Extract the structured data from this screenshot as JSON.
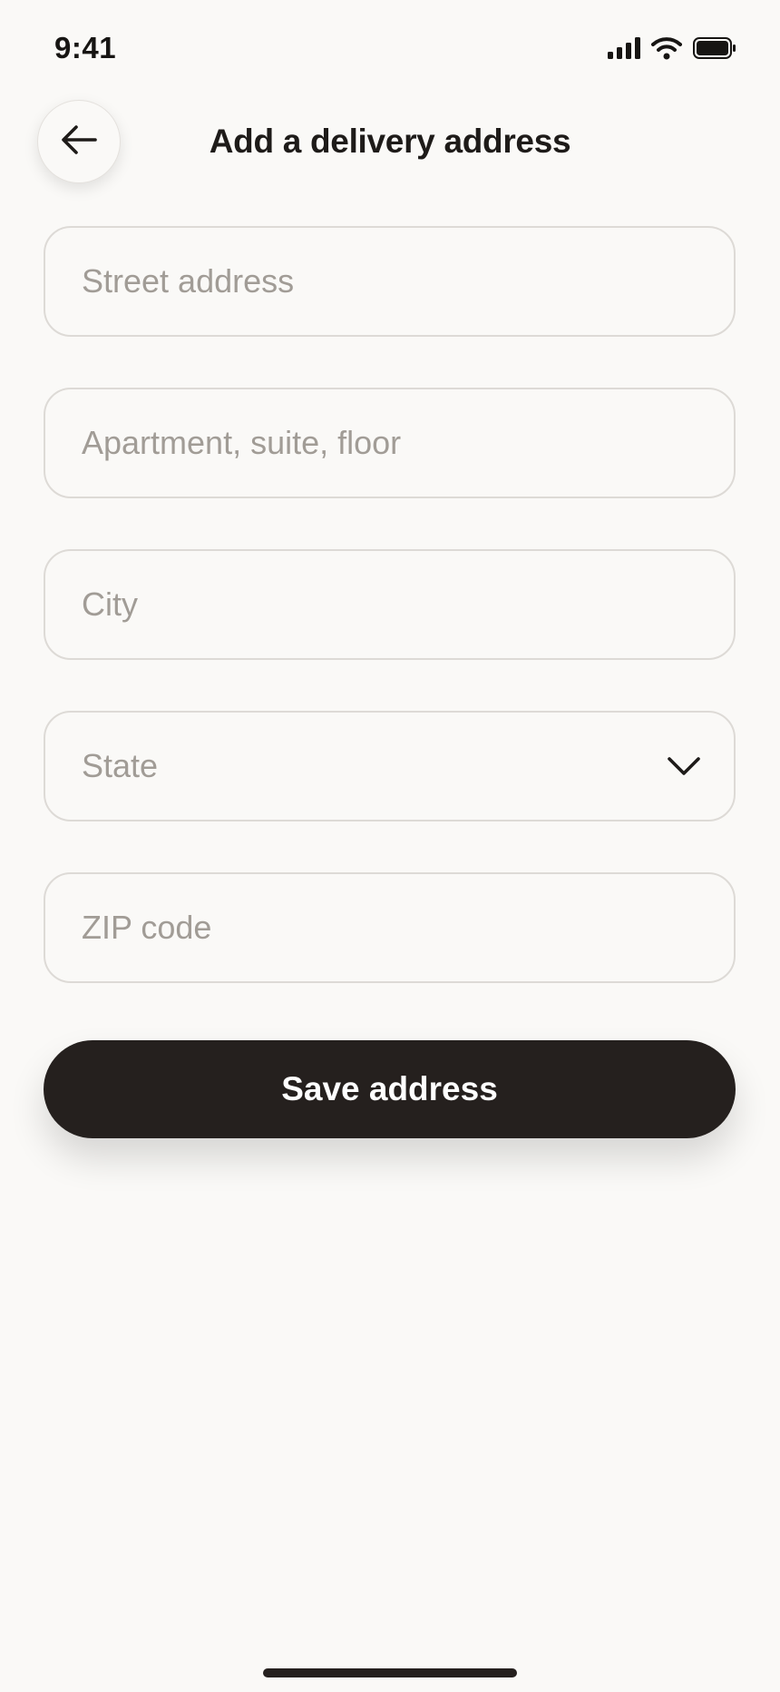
{
  "status_bar": {
    "time": "9:41",
    "icons": [
      "cellular-signal-icon",
      "wifi-icon",
      "battery-icon"
    ]
  },
  "header": {
    "back_icon": "arrow-left-icon",
    "title": "Add a delivery address"
  },
  "form": {
    "street": {
      "placeholder": "Street address",
      "value": ""
    },
    "apartment": {
      "placeholder": "Apartment, suite, floor",
      "value": ""
    },
    "city": {
      "placeholder": "City",
      "value": ""
    },
    "state": {
      "placeholder": "State",
      "icon": "chevron-down-icon"
    },
    "zip": {
      "placeholder": "ZIP code",
      "value": ""
    }
  },
  "actions": {
    "save_label": "Save address"
  },
  "colors": {
    "background": "#FAF9F7",
    "primary": "#25201E",
    "placeholder": "#A19C96",
    "border": "#DDDAD6"
  }
}
